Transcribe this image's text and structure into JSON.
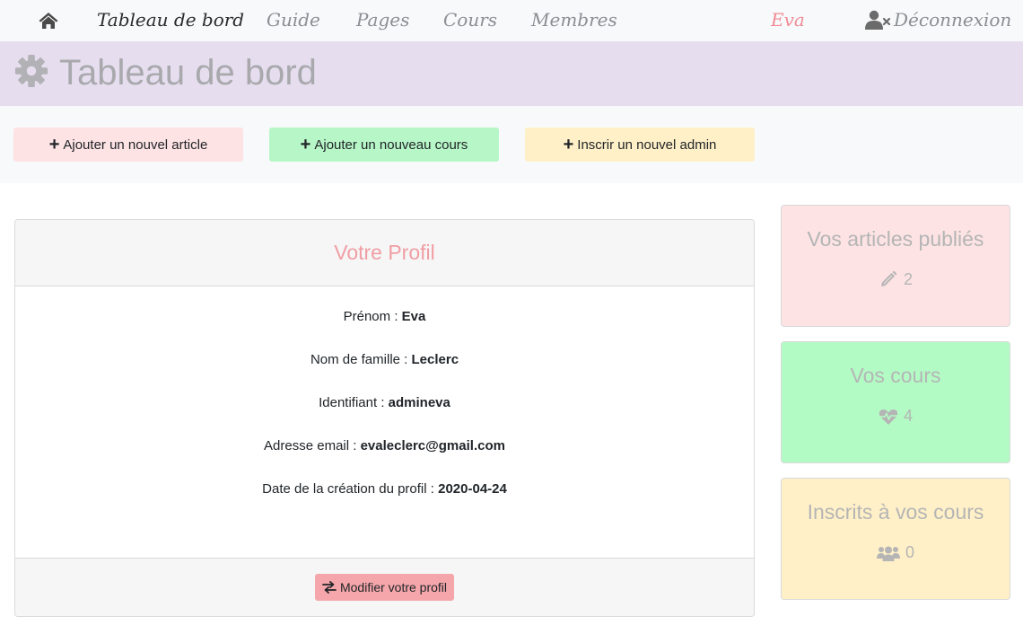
{
  "nav": {
    "home_icon": "home-icon",
    "items": [
      {
        "label": "Tableau de bord"
      },
      {
        "label": "Guide"
      },
      {
        "label": "Pages"
      },
      {
        "label": "Cours"
      },
      {
        "label": "Membres"
      }
    ],
    "user": "Eva",
    "logout_label": "Déconnexion",
    "logout_icon": "user-times-icon"
  },
  "header": {
    "icon": "gear-icon",
    "title": "Tableau de bord"
  },
  "actions": {
    "add_article": "Ajouter un nouvel article",
    "add_course": "Ajouter un nouveau cours",
    "add_admin": "Inscrir un nouvel admin"
  },
  "profile": {
    "title": "Votre Profil",
    "fields": [
      {
        "label": "Prénom : ",
        "value": "Eva"
      },
      {
        "label": "Nom de famille : ",
        "value": "Leclerc"
      },
      {
        "label": "Identifiant : ",
        "value": "admineva"
      },
      {
        "label": "Adresse email : ",
        "value": "evaleclerc@gmail.com"
      },
      {
        "label": "Date de la création du profil : ",
        "value": "2020-04-24"
      }
    ],
    "edit_label": "Modifier votre profil"
  },
  "stats": {
    "articles": {
      "title": "Vos articles publiés",
      "value": "2",
      "icon": "pencil-icon"
    },
    "courses": {
      "title": "Vos cours",
      "value": "4",
      "icon": "heartbeat-icon"
    },
    "students": {
      "title": "Inscrits à vos cours",
      "value": "0",
      "icon": "users-icon"
    }
  },
  "colors": {
    "nav_bg": "#f8f9fa",
    "header_bg": "#e6deef",
    "accent_pink": "#f09ea4",
    "pink_bg": "#fde3e4",
    "green_bg": "#b3fbc5",
    "yellow_bg": "#fff0c7"
  }
}
